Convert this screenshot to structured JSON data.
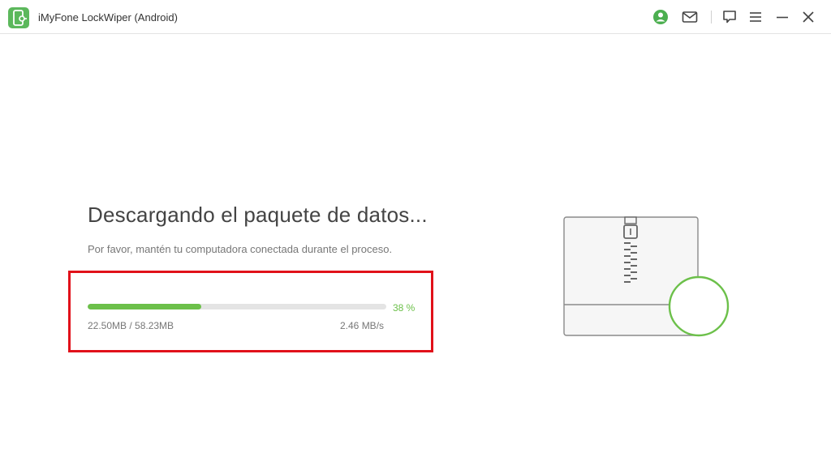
{
  "window": {
    "title": "iMyFone LockWiper (Android)"
  },
  "toolbar": {
    "icons": [
      "account-icon",
      "mail-icon",
      "feedback-icon",
      "menu-icon",
      "minimize-icon",
      "close-icon"
    ],
    "accent_color": "#5cb85c"
  },
  "main": {
    "heading": "Descargando el paquete de datos...",
    "subtext": "Por favor, mantén tu computadora conectada durante el proceso.",
    "progress": {
      "percent_value": 38,
      "percent_label": "38 %",
      "downloaded": "22.50MB / 58.23MB",
      "speed": "2.46 MB/s",
      "fill_color": "#6cc04a",
      "track_color": "#e4e4e4"
    },
    "highlight_color": "#e1111a"
  }
}
